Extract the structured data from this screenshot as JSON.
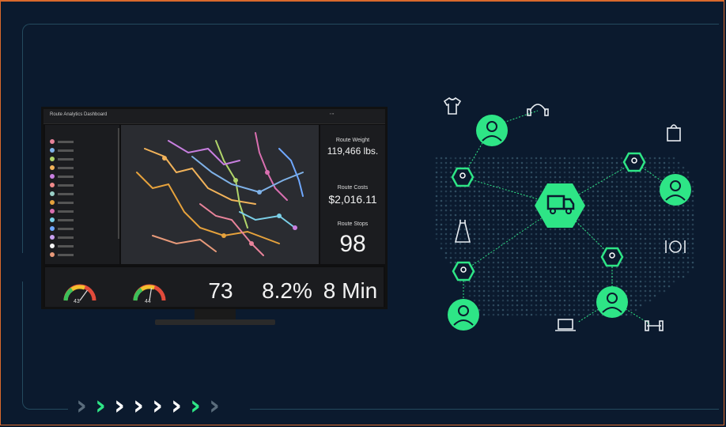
{
  "dashboard": {
    "title": "Route Analytics Dashboard",
    "kpis": [
      {
        "label": "Route Weight",
        "value": "119,466 lbs."
      },
      {
        "label": "Route Costs",
        "value": "$2,016.11"
      },
      {
        "label": "Route Stops",
        "value": "98"
      }
    ],
    "bottom": [
      {
        "value": "43",
        "level": 0.7
      },
      {
        "value": "44",
        "level": 0.55
      },
      {
        "value": "73"
      },
      {
        "value": "8.2%"
      },
      {
        "value": "8 Min"
      }
    ],
    "legend_colors": [
      "#e8839a",
      "#7fb2e8",
      "#b0d46a",
      "#f2b35a",
      "#c87fe0",
      "#f08a8a",
      "#9bd1c8",
      "#e6a23c",
      "#d96fb0",
      "#7bd0e8",
      "#6fa8ff",
      "#c9a0f0",
      "#f4f4f4",
      "#e89a7a"
    ]
  },
  "network": {
    "accent": "#2ee586",
    "icons": [
      "shirt-icon",
      "headphones-icon",
      "shopping-bag-icon",
      "dress-icon",
      "dining-icon",
      "laptop-icon",
      "dumbbell-icon",
      "delivery-truck-icon"
    ]
  },
  "colors": {
    "background": "#0b1a2e",
    "border": "#d9692c",
    "chevrons": [
      "#5a6c7c",
      "#2ee586",
      "#ffffff",
      "#ffffff",
      "#ffffff",
      "#ffffff",
      "#2ee586",
      "#5a6c7c"
    ]
  }
}
